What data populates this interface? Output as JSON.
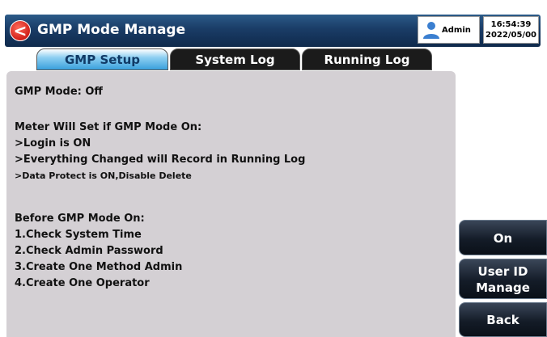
{
  "header": {
    "back_icon": "<",
    "title": "GMP Mode Manage",
    "user": "Admin",
    "time": "16:54:39",
    "date": "2022/05/00"
  },
  "tabs": [
    {
      "label": "GMP Setup",
      "active": true
    },
    {
      "label": "System Log",
      "active": false
    },
    {
      "label": "Running Log",
      "active": false
    }
  ],
  "content": {
    "mode_status": "GMP Mode: Off",
    "meter_heading": "Meter Will Set if GMP Mode On:",
    "meter_items": [
      ">Login is ON",
      ">Everything Changed will Record in Running Log",
      ">Data Protect is ON,Disable Delete"
    ],
    "before_heading": "Before GMP Mode On:",
    "before_items": [
      "1.Check System Time",
      "2.Check Admin Password",
      "3.Create One Method Admin",
      "4.Create One Operator"
    ]
  },
  "side_buttons": {
    "on": "On",
    "user_id_line1": "User ID",
    "user_id_line2": "Manage",
    "back": "Back"
  },
  "colors": {
    "titlebar": "#1a3c66",
    "panel": "#d4d0d4",
    "active_tab": "#3aa0dc",
    "back_icon": "#d0201a"
  }
}
